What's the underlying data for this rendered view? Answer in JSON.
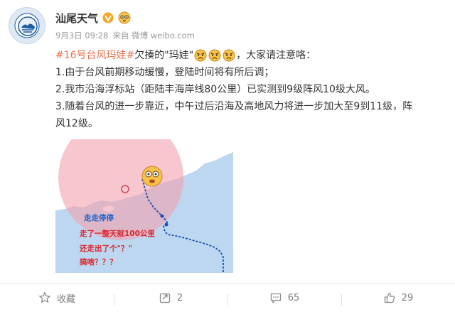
{
  "user": {
    "name": "汕尾天气"
  },
  "meta": {
    "date": "9月3日 09:28",
    "source": "来自 微博 weibo.com"
  },
  "post": {
    "hashtag": "#16号台风玛娃#",
    "line1_text": "欠揍的\"玛娃\"",
    "line1_tail": "，大家请注意咯：",
    "line2": "1.由于台风前期移动缓慢，登陆时间将有所后调；",
    "line3": "2.我市沿海浮标站（距陆丰海岸线80公里）已实测到9级阵风10级大风。",
    "line4": "3.随着台风的进一步靠近，中午过后沿海及高地风力将进一步加大至9到11级，阵",
    "line5": "风12级。"
  },
  "image": {
    "annotations": [
      "走走停停",
      "走了一整天就100公里",
      "还走出了个\"？\"",
      "搞啥？？？"
    ],
    "colors": {
      "sea": "#bcd7ef",
      "land": "#ffffff",
      "wind_circle": "#f3a0ad",
      "track": "#1f4fb5",
      "annotation": "#d9272e",
      "annotation_blue": "#1f62c8"
    }
  },
  "actions": {
    "favorite": "收藏",
    "repost": "2",
    "comment": "65",
    "like": "29"
  },
  "colors": {
    "hashtag": "#eb7350",
    "username": "#333333",
    "meta": "#9a9a9a",
    "verified": "#f5a623"
  }
}
